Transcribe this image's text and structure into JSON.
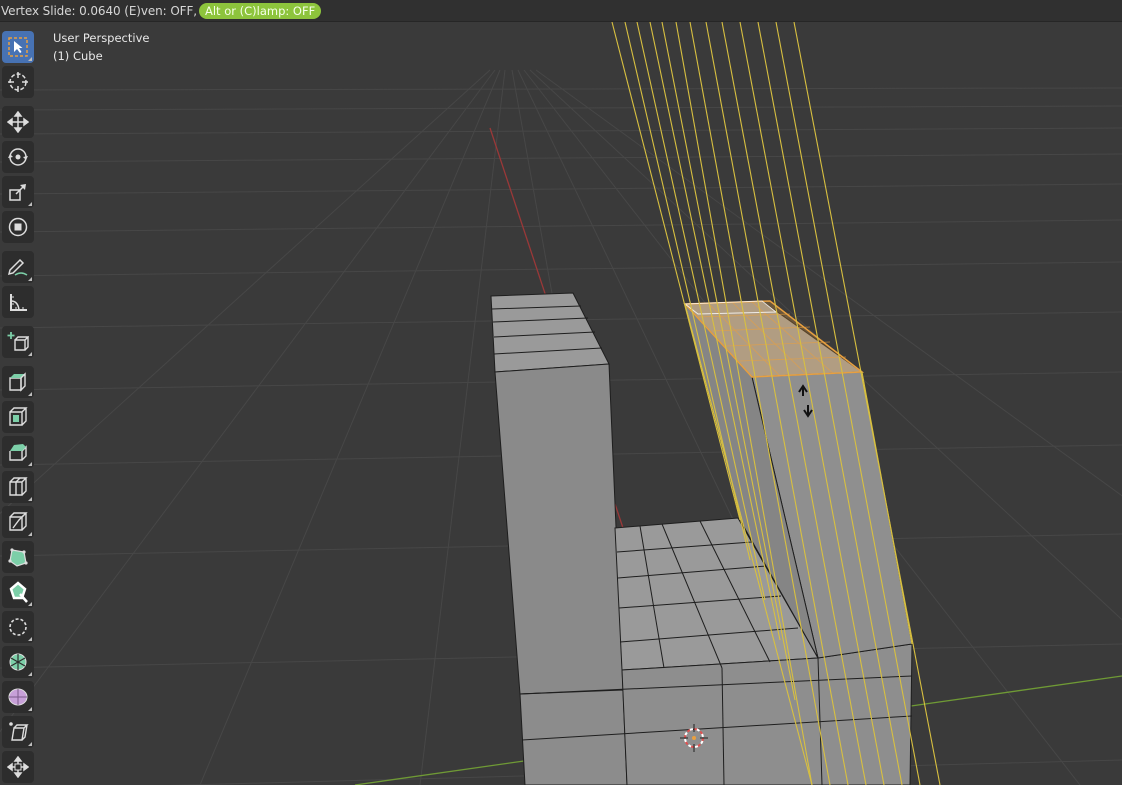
{
  "header": {
    "status_text": "Vertex Slide: 0.0640 (E)ven: OFF,",
    "clamp_pill": "Alt or (C)lamp: OFF"
  },
  "viewport": {
    "view_name": "User Perspective",
    "object_name": "(1) Cube"
  },
  "colors": {
    "accent_active_tool": "#4772b3",
    "status_pill": "#8dc43c",
    "selection_orange": "#e8a040",
    "slide_guides": "#d8c040",
    "x_axis": "#b83a3a",
    "y_axis": "#7aa83a"
  },
  "toolbar": {
    "tools": [
      {
        "name": "select-box-tool",
        "icon": "select-box-icon",
        "active": true
      },
      {
        "name": "cursor-tool",
        "icon": "cursor-icon"
      },
      {
        "name": "move-tool",
        "icon": "move-icon"
      },
      {
        "name": "rotate-tool",
        "icon": "rotate-icon"
      },
      {
        "name": "scale-tool",
        "icon": "scale-icon"
      },
      {
        "name": "transform-tool",
        "icon": "transform-icon"
      },
      {
        "name": "annotate-tool",
        "icon": "annotate-icon"
      },
      {
        "name": "measure-tool",
        "icon": "measure-icon"
      },
      {
        "name": "add-cube-tool",
        "icon": "add-cube-icon"
      },
      {
        "name": "extrude-region-tool",
        "icon": "extrude-icon"
      },
      {
        "name": "inset-faces-tool",
        "icon": "inset-icon"
      },
      {
        "name": "bevel-tool",
        "icon": "bevel-icon"
      },
      {
        "name": "loop-cut-tool",
        "icon": "loop-cut-icon"
      },
      {
        "name": "knife-tool",
        "icon": "knife-icon"
      },
      {
        "name": "poly-build-tool",
        "icon": "poly-build-icon"
      },
      {
        "name": "spin-tool",
        "icon": "spin-icon"
      },
      {
        "name": "smooth-tool",
        "icon": "smooth-icon"
      },
      {
        "name": "edge-slide-tool",
        "icon": "edge-slide-icon"
      },
      {
        "name": "shrink-fatten-tool",
        "icon": "shrink-fatten-icon"
      },
      {
        "name": "shear-tool",
        "icon": "shear-icon"
      },
      {
        "name": "rip-region-tool",
        "icon": "rip-icon"
      }
    ]
  }
}
